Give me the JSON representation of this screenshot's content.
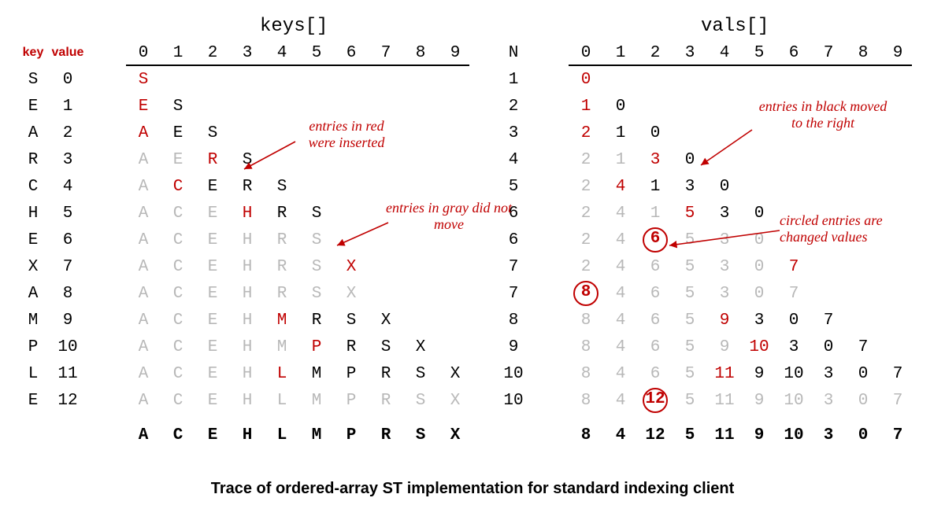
{
  "chart_data": {
    "type": "table",
    "title": "Trace of ordered-array ST implementation for standard indexing client",
    "input_sequence": "SEARCHEXAMPLE",
    "keys_header": "keys[]",
    "vals_header": "vals[]",
    "kv_headers": [
      "key",
      "value"
    ],
    "legend_red": "entries in red were inserted",
    "legend_gray": "entries in gray did not move",
    "legend_black": "entries in black moved to the right",
    "legend_circle": "circled entries are changed values",
    "index_labels": [
      "0",
      "1",
      "2",
      "3",
      "4",
      "5",
      "6",
      "7",
      "8",
      "9"
    ],
    "rows": [
      {
        "key": "S",
        "value": 0,
        "N": 1,
        "keys": [
          {
            "t": "S",
            "c": "red"
          }
        ],
        "vals": [
          {
            "t": "0",
            "c": "red"
          }
        ]
      },
      {
        "key": "E",
        "value": 1,
        "N": 2,
        "keys": [
          {
            "t": "E",
            "c": "red"
          },
          {
            "t": "S",
            "c": "black"
          }
        ],
        "vals": [
          {
            "t": "1",
            "c": "red"
          },
          {
            "t": "0",
            "c": "black"
          }
        ]
      },
      {
        "key": "A",
        "value": 2,
        "N": 3,
        "keys": [
          {
            "t": "A",
            "c": "red"
          },
          {
            "t": "E",
            "c": "black"
          },
          {
            "t": "S",
            "c": "black"
          }
        ],
        "vals": [
          {
            "t": "2",
            "c": "red"
          },
          {
            "t": "1",
            "c": "black"
          },
          {
            "t": "0",
            "c": "black"
          }
        ]
      },
      {
        "key": "R",
        "value": 3,
        "N": 4,
        "keys": [
          {
            "t": "A",
            "c": "gray"
          },
          {
            "t": "E",
            "c": "gray"
          },
          {
            "t": "R",
            "c": "red"
          },
          {
            "t": "S",
            "c": "black"
          }
        ],
        "vals": [
          {
            "t": "2",
            "c": "gray"
          },
          {
            "t": "1",
            "c": "gray"
          },
          {
            "t": "3",
            "c": "red"
          },
          {
            "t": "0",
            "c": "black"
          }
        ]
      },
      {
        "key": "C",
        "value": 4,
        "N": 5,
        "keys": [
          {
            "t": "A",
            "c": "gray"
          },
          {
            "t": "C",
            "c": "red"
          },
          {
            "t": "E",
            "c": "black"
          },
          {
            "t": "R",
            "c": "black"
          },
          {
            "t": "S",
            "c": "black"
          }
        ],
        "vals": [
          {
            "t": "2",
            "c": "gray"
          },
          {
            "t": "4",
            "c": "red"
          },
          {
            "t": "1",
            "c": "black"
          },
          {
            "t": "3",
            "c": "black"
          },
          {
            "t": "0",
            "c": "black"
          }
        ]
      },
      {
        "key": "H",
        "value": 5,
        "N": 6,
        "keys": [
          {
            "t": "A",
            "c": "gray"
          },
          {
            "t": "C",
            "c": "gray"
          },
          {
            "t": "E",
            "c": "gray"
          },
          {
            "t": "H",
            "c": "red"
          },
          {
            "t": "R",
            "c": "black"
          },
          {
            "t": "S",
            "c": "black"
          }
        ],
        "vals": [
          {
            "t": "2",
            "c": "gray"
          },
          {
            "t": "4",
            "c": "gray"
          },
          {
            "t": "1",
            "c": "gray"
          },
          {
            "t": "5",
            "c": "red"
          },
          {
            "t": "3",
            "c": "black"
          },
          {
            "t": "0",
            "c": "black"
          }
        ]
      },
      {
        "key": "E",
        "value": 6,
        "N": 6,
        "keys": [
          {
            "t": "A",
            "c": "gray"
          },
          {
            "t": "C",
            "c": "gray"
          },
          {
            "t": "E",
            "c": "gray"
          },
          {
            "t": "H",
            "c": "gray"
          },
          {
            "t": "R",
            "c": "gray"
          },
          {
            "t": "S",
            "c": "gray"
          }
        ],
        "vals": [
          {
            "t": "2",
            "c": "gray"
          },
          {
            "t": "4",
            "c": "gray"
          },
          {
            "t": "6",
            "c": "circled"
          },
          {
            "t": "5",
            "c": "gray"
          },
          {
            "t": "3",
            "c": "gray"
          },
          {
            "t": "0",
            "c": "gray"
          }
        ]
      },
      {
        "key": "X",
        "value": 7,
        "N": 7,
        "keys": [
          {
            "t": "A",
            "c": "gray"
          },
          {
            "t": "C",
            "c": "gray"
          },
          {
            "t": "E",
            "c": "gray"
          },
          {
            "t": "H",
            "c": "gray"
          },
          {
            "t": "R",
            "c": "gray"
          },
          {
            "t": "S",
            "c": "gray"
          },
          {
            "t": "X",
            "c": "red"
          }
        ],
        "vals": [
          {
            "t": "2",
            "c": "gray"
          },
          {
            "t": "4",
            "c": "gray"
          },
          {
            "t": "6",
            "c": "gray"
          },
          {
            "t": "5",
            "c": "gray"
          },
          {
            "t": "3",
            "c": "gray"
          },
          {
            "t": "0",
            "c": "gray"
          },
          {
            "t": "7",
            "c": "red"
          }
        ]
      },
      {
        "key": "A",
        "value": 8,
        "N": 7,
        "keys": [
          {
            "t": "A",
            "c": "gray"
          },
          {
            "t": "C",
            "c": "gray"
          },
          {
            "t": "E",
            "c": "gray"
          },
          {
            "t": "H",
            "c": "gray"
          },
          {
            "t": "R",
            "c": "gray"
          },
          {
            "t": "S",
            "c": "gray"
          },
          {
            "t": "X",
            "c": "gray"
          }
        ],
        "vals": [
          {
            "t": "8",
            "c": "circled"
          },
          {
            "t": "4",
            "c": "gray"
          },
          {
            "t": "6",
            "c": "gray"
          },
          {
            "t": "5",
            "c": "gray"
          },
          {
            "t": "3",
            "c": "gray"
          },
          {
            "t": "0",
            "c": "gray"
          },
          {
            "t": "7",
            "c": "gray"
          }
        ]
      },
      {
        "key": "M",
        "value": 9,
        "N": 8,
        "keys": [
          {
            "t": "A",
            "c": "gray"
          },
          {
            "t": "C",
            "c": "gray"
          },
          {
            "t": "E",
            "c": "gray"
          },
          {
            "t": "H",
            "c": "gray"
          },
          {
            "t": "M",
            "c": "red"
          },
          {
            "t": "R",
            "c": "black"
          },
          {
            "t": "S",
            "c": "black"
          },
          {
            "t": "X",
            "c": "black"
          }
        ],
        "vals": [
          {
            "t": "8",
            "c": "gray"
          },
          {
            "t": "4",
            "c": "gray"
          },
          {
            "t": "6",
            "c": "gray"
          },
          {
            "t": "5",
            "c": "gray"
          },
          {
            "t": "9",
            "c": "red"
          },
          {
            "t": "3",
            "c": "black"
          },
          {
            "t": "0",
            "c": "black"
          },
          {
            "t": "7",
            "c": "black"
          }
        ]
      },
      {
        "key": "P",
        "value": 10,
        "N": 9,
        "keys": [
          {
            "t": "A",
            "c": "gray"
          },
          {
            "t": "C",
            "c": "gray"
          },
          {
            "t": "E",
            "c": "gray"
          },
          {
            "t": "H",
            "c": "gray"
          },
          {
            "t": "M",
            "c": "gray"
          },
          {
            "t": "P",
            "c": "red"
          },
          {
            "t": "R",
            "c": "black"
          },
          {
            "t": "S",
            "c": "black"
          },
          {
            "t": "X",
            "c": "black"
          }
        ],
        "vals": [
          {
            "t": "8",
            "c": "gray"
          },
          {
            "t": "4",
            "c": "gray"
          },
          {
            "t": "6",
            "c": "gray"
          },
          {
            "t": "5",
            "c": "gray"
          },
          {
            "t": "9",
            "c": "gray"
          },
          {
            "t": "10",
            "c": "red"
          },
          {
            "t": "3",
            "c": "black"
          },
          {
            "t": "0",
            "c": "black"
          },
          {
            "t": "7",
            "c": "black"
          }
        ]
      },
      {
        "key": "L",
        "value": 11,
        "N": 10,
        "keys": [
          {
            "t": "A",
            "c": "gray"
          },
          {
            "t": "C",
            "c": "gray"
          },
          {
            "t": "E",
            "c": "gray"
          },
          {
            "t": "H",
            "c": "gray"
          },
          {
            "t": "L",
            "c": "red"
          },
          {
            "t": "M",
            "c": "black"
          },
          {
            "t": "P",
            "c": "black"
          },
          {
            "t": "R",
            "c": "black"
          },
          {
            "t": "S",
            "c": "black"
          },
          {
            "t": "X",
            "c": "black"
          }
        ],
        "vals": [
          {
            "t": "8",
            "c": "gray"
          },
          {
            "t": "4",
            "c": "gray"
          },
          {
            "t": "6",
            "c": "gray"
          },
          {
            "t": "5",
            "c": "gray"
          },
          {
            "t": "11",
            "c": "red"
          },
          {
            "t": "9",
            "c": "black"
          },
          {
            "t": "10",
            "c": "black"
          },
          {
            "t": "3",
            "c": "black"
          },
          {
            "t": "0",
            "c": "black"
          },
          {
            "t": "7",
            "c": "black"
          }
        ]
      },
      {
        "key": "E",
        "value": 12,
        "N": 10,
        "keys": [
          {
            "t": "A",
            "c": "gray"
          },
          {
            "t": "C",
            "c": "gray"
          },
          {
            "t": "E",
            "c": "gray"
          },
          {
            "t": "H",
            "c": "gray"
          },
          {
            "t": "L",
            "c": "gray"
          },
          {
            "t": "M",
            "c": "gray"
          },
          {
            "t": "P",
            "c": "gray"
          },
          {
            "t": "R",
            "c": "gray"
          },
          {
            "t": "S",
            "c": "gray"
          },
          {
            "t": "X",
            "c": "gray"
          }
        ],
        "vals": [
          {
            "t": "8",
            "c": "gray"
          },
          {
            "t": "4",
            "c": "gray"
          },
          {
            "t": "12",
            "c": "circled"
          },
          {
            "t": "5",
            "c": "gray"
          },
          {
            "t": "11",
            "c": "gray"
          },
          {
            "t": "9",
            "c": "gray"
          },
          {
            "t": "10",
            "c": "gray"
          },
          {
            "t": "3",
            "c": "gray"
          },
          {
            "t": "0",
            "c": "gray"
          },
          {
            "t": "7",
            "c": "gray"
          }
        ]
      }
    ],
    "final_keys": [
      "A",
      "C",
      "E",
      "H",
      "L",
      "M",
      "P",
      "R",
      "S",
      "X"
    ],
    "final_vals": [
      "8",
      "4",
      "12",
      "5",
      "11",
      "9",
      "10",
      "3",
      "0",
      "7"
    ]
  }
}
